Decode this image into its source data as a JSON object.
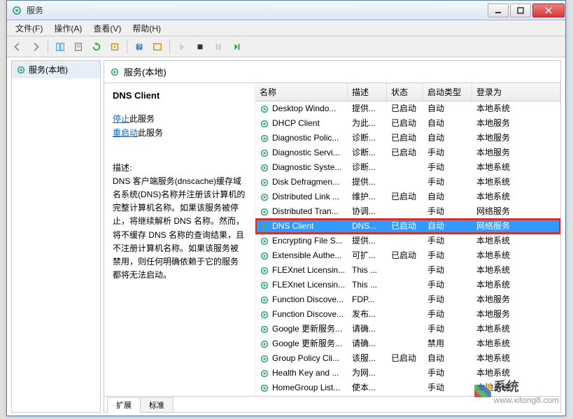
{
  "window": {
    "title": "服务"
  },
  "menu": {
    "file": "文件(F)",
    "action": "操作(A)",
    "view": "查看(V)",
    "help": "帮助(H)"
  },
  "left": {
    "root": "服务(本地)"
  },
  "header": {
    "title": "服务(本地)"
  },
  "detail": {
    "name": "DNS Client",
    "stop": "停止",
    "stop_suffix": "此服务",
    "restart": "重启动",
    "restart_suffix": "此服务",
    "desc_label": "描述:",
    "desc": "DNS 客户端服务(dnscache)缓存域名系统(DNS)名称并注册该计算机的完整计算机名称。如果该服务被停止，将继续解析 DNS 名称。然而，将不缓存 DNS 名称的查询结果，且不注册计算机名称。如果该服务被禁用，则任何明确依赖于它的服务都将无法启动。"
  },
  "columns": {
    "name": "名称",
    "desc": "描述",
    "status": "状态",
    "start": "启动类型",
    "logon": "登录为"
  },
  "rows": [
    {
      "name": "Desktop Windo...",
      "desc": "提供...",
      "status": "已启动",
      "start": "自动",
      "logon": "本地系统"
    },
    {
      "name": "DHCP Client",
      "desc": "为此...",
      "status": "已启动",
      "start": "自动",
      "logon": "本地服务"
    },
    {
      "name": "Diagnostic Polic...",
      "desc": "诊断...",
      "status": "已启动",
      "start": "自动",
      "logon": "本地服务"
    },
    {
      "name": "Diagnostic Servi...",
      "desc": "诊断...",
      "status": "已启动",
      "start": "手动",
      "logon": "本地服务"
    },
    {
      "name": "Diagnostic Syste...",
      "desc": "诊断...",
      "status": "",
      "start": "手动",
      "logon": "本地系统"
    },
    {
      "name": "Disk Defragmen...",
      "desc": "提供...",
      "status": "",
      "start": "手动",
      "logon": "本地系统"
    },
    {
      "name": "Distributed Link ...",
      "desc": "维护...",
      "status": "已启动",
      "start": "自动",
      "logon": "本地系统"
    },
    {
      "name": "Distributed Tran...",
      "desc": "协调...",
      "status": "",
      "start": "手动",
      "logon": "网络服务"
    },
    {
      "name": "DNS Client",
      "desc": "DNS...",
      "status": "已启动",
      "start": "自动",
      "logon": "网络服务",
      "sel": true
    },
    {
      "name": "Encrypting File S...",
      "desc": "提供...",
      "status": "",
      "start": "手动",
      "logon": "本地系统"
    },
    {
      "name": "Extensible Authe...",
      "desc": "可扩...",
      "status": "已启动",
      "start": "手动",
      "logon": "本地系统"
    },
    {
      "name": "FLEXnet Licensin...",
      "desc": "This ...",
      "status": "",
      "start": "手动",
      "logon": "本地系统"
    },
    {
      "name": "FLEXnet Licensin...",
      "desc": "This ...",
      "status": "",
      "start": "手动",
      "logon": "本地系统"
    },
    {
      "name": "Function Discove...",
      "desc": "FDP...",
      "status": "",
      "start": "手动",
      "logon": "本地服务"
    },
    {
      "name": "Function Discove...",
      "desc": "发布...",
      "status": "",
      "start": "手动",
      "logon": "本地服务"
    },
    {
      "name": "Google 更新服务...",
      "desc": "请确...",
      "status": "",
      "start": "手动",
      "logon": "本地系统"
    },
    {
      "name": "Google 更新服务...",
      "desc": "请确...",
      "status": "",
      "start": "禁用",
      "logon": "本地系统"
    },
    {
      "name": "Group Policy Cli...",
      "desc": "该服...",
      "status": "已启动",
      "start": "自动",
      "logon": "本地系统"
    },
    {
      "name": "Health Key and ...",
      "desc": "为网...",
      "status": "",
      "start": "手动",
      "logon": "本地系统"
    },
    {
      "name": "HomeGroup List...",
      "desc": "使本...",
      "status": "",
      "start": "手动",
      "logon": "本地系统"
    }
  ],
  "tabs": {
    "ext": "扩展",
    "std": "标准"
  },
  "watermark": {
    "main": "系统",
    "sub": "www.xitong8.com"
  }
}
